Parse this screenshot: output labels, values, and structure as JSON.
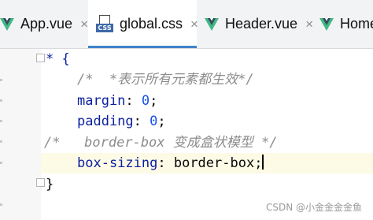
{
  "tabs": [
    {
      "label": "App.vue",
      "icon": "vue-icon",
      "active": false,
      "closable": true
    },
    {
      "label": "global.css",
      "icon": "css-file-icon",
      "icon_text": "CSS",
      "active": true,
      "closable": true
    },
    {
      "label": "Header.vue",
      "icon": "vue-icon",
      "active": false,
      "closable": true
    },
    {
      "label": "HomeV",
      "icon": "vue-icon",
      "active": false,
      "closable": false
    }
  ],
  "close_glyph": "×",
  "editor": {
    "lines": [
      {
        "selector": "* {"
      },
      {
        "comment": "/*  *表示所有元素都生效*/"
      },
      {
        "property": "margin",
        "value": "0"
      },
      {
        "property": "padding",
        "value": "0"
      },
      {
        "comment": "/*   border-box 变成盒状模型 */"
      },
      {
        "property": "box-sizing",
        "value": "border-box"
      },
      {
        "closing": "}"
      }
    ]
  },
  "colors": {
    "active_tab_underline": "#4083c9",
    "current_line": "#fdfbe6",
    "property": "#0b1fa0",
    "number": "#1750eb",
    "comment": "#8c8c8c",
    "vue_green": "#41b883",
    "vue_dark": "#35495e"
  },
  "watermark": "CSDN @小金金金金鱼"
}
